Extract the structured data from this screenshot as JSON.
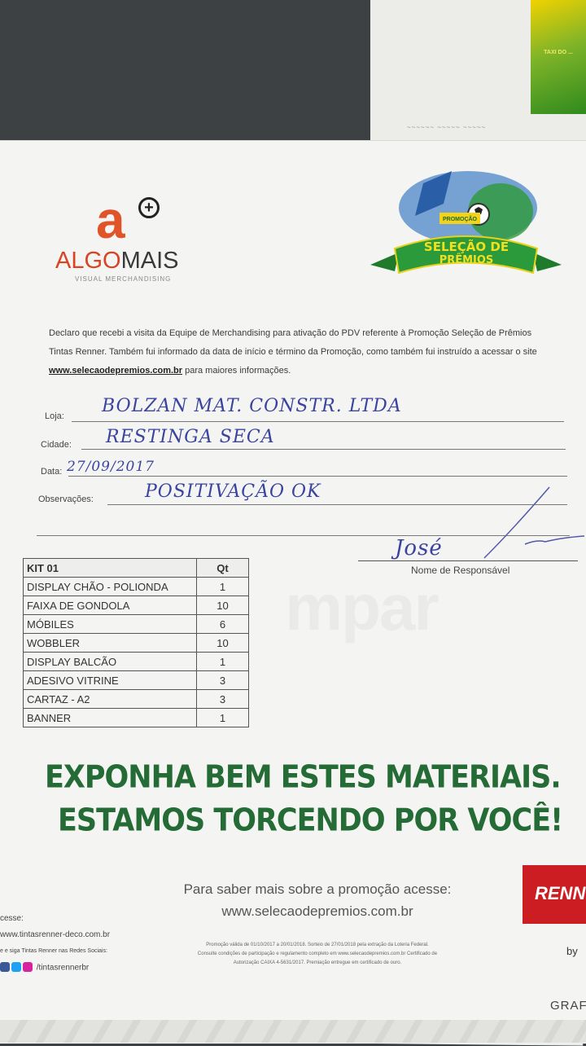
{
  "background": {
    "flyer_text": "TAXI DO ..."
  },
  "logo": {
    "a_letter": "a",
    "plus": "+",
    "algo": "ALGO",
    "mais": "MAIS",
    "subtitle": "VISUAL MERCHANDISING"
  },
  "promo": {
    "ribbon_line1": "SELEÇÃO DE",
    "ribbon_line2": "PRÊMIOS",
    "badge": "PROMOÇÃO"
  },
  "declaration": {
    "text_before": "Declaro que recebi a visita da Equipe de Merchandising para ativação do PDV referente à Promoção Seleção de Prêmios Tintas Renner. Também fui informado da data de início e término da Promoção, como também fui instruído a acessar o site ",
    "site": "www.selecaodepremios.com.br",
    "text_after": " para maiores informações."
  },
  "form": {
    "loja_label": "Loja:",
    "loja_value": "BOLZAN MAT. CONSTR. LTDA",
    "cidade_label": "Cidade:",
    "cidade_value": "RESTINGA SECA",
    "data_label": "Data:",
    "data_value": "27/09/2017",
    "obs_label": "Observações:",
    "obs_value": "POSITIVAÇÃO OK",
    "signature": "José",
    "signature_label": "Nome de Responsável"
  },
  "kit": {
    "header_item": "KIT 01",
    "header_qt": "Qt",
    "rows": [
      {
        "item": "DISPLAY CHÃO - POLIONDA",
        "qt": "1"
      },
      {
        "item": "FAIXA DE GONDOLA",
        "qt": "10"
      },
      {
        "item": "MÓBILES",
        "qt": "6"
      },
      {
        "item": "WOBBLER",
        "qt": "10"
      },
      {
        "item": "DISPLAY BALCÃO",
        "qt": "1"
      },
      {
        "item": "ADESIVO VITRINE",
        "qt": "3"
      },
      {
        "item": "CARTAZ - A2",
        "qt": "3"
      },
      {
        "item": "BANNER",
        "qt": "1"
      }
    ]
  },
  "headline": {
    "line1": "EXPONHA BEM ESTES MATERIAIS.",
    "line2": "ESTAMOS TORCENDO POR VOCÊ!"
  },
  "footer": {
    "promo_text": "Para saber mais sobre a promoção acesse:",
    "promo_url": "www.selecaodepremios.com.br",
    "left_access": "cesse:",
    "left_url": "www.tintasrenner-deco.com.br",
    "left_follow": "e e siga Tintas Renner nas Redes Sociais:",
    "left_social": "/tintasrennerbr",
    "legal_1": "Promoção válida de 01/10/2017 a 20/01/2018. Sorteio de 27/01/2018 pela extração da Loteria Federal.",
    "legal_2": "Consulte condições de participação e regulamento completo em www.selecaodepremios.com.br Certificado de",
    "legal_3": "Autorização CAIXA 4-5631/2017. Premiação entregue em certificado de ouro.",
    "renner": "RENN",
    "by": "by",
    "grafica": "GRAF"
  },
  "colors": {
    "headline_green": "#256b36",
    "logo_orange": "#d94323",
    "renner_red": "#cc1d22",
    "handwriting_blue": "#3b43a0"
  }
}
